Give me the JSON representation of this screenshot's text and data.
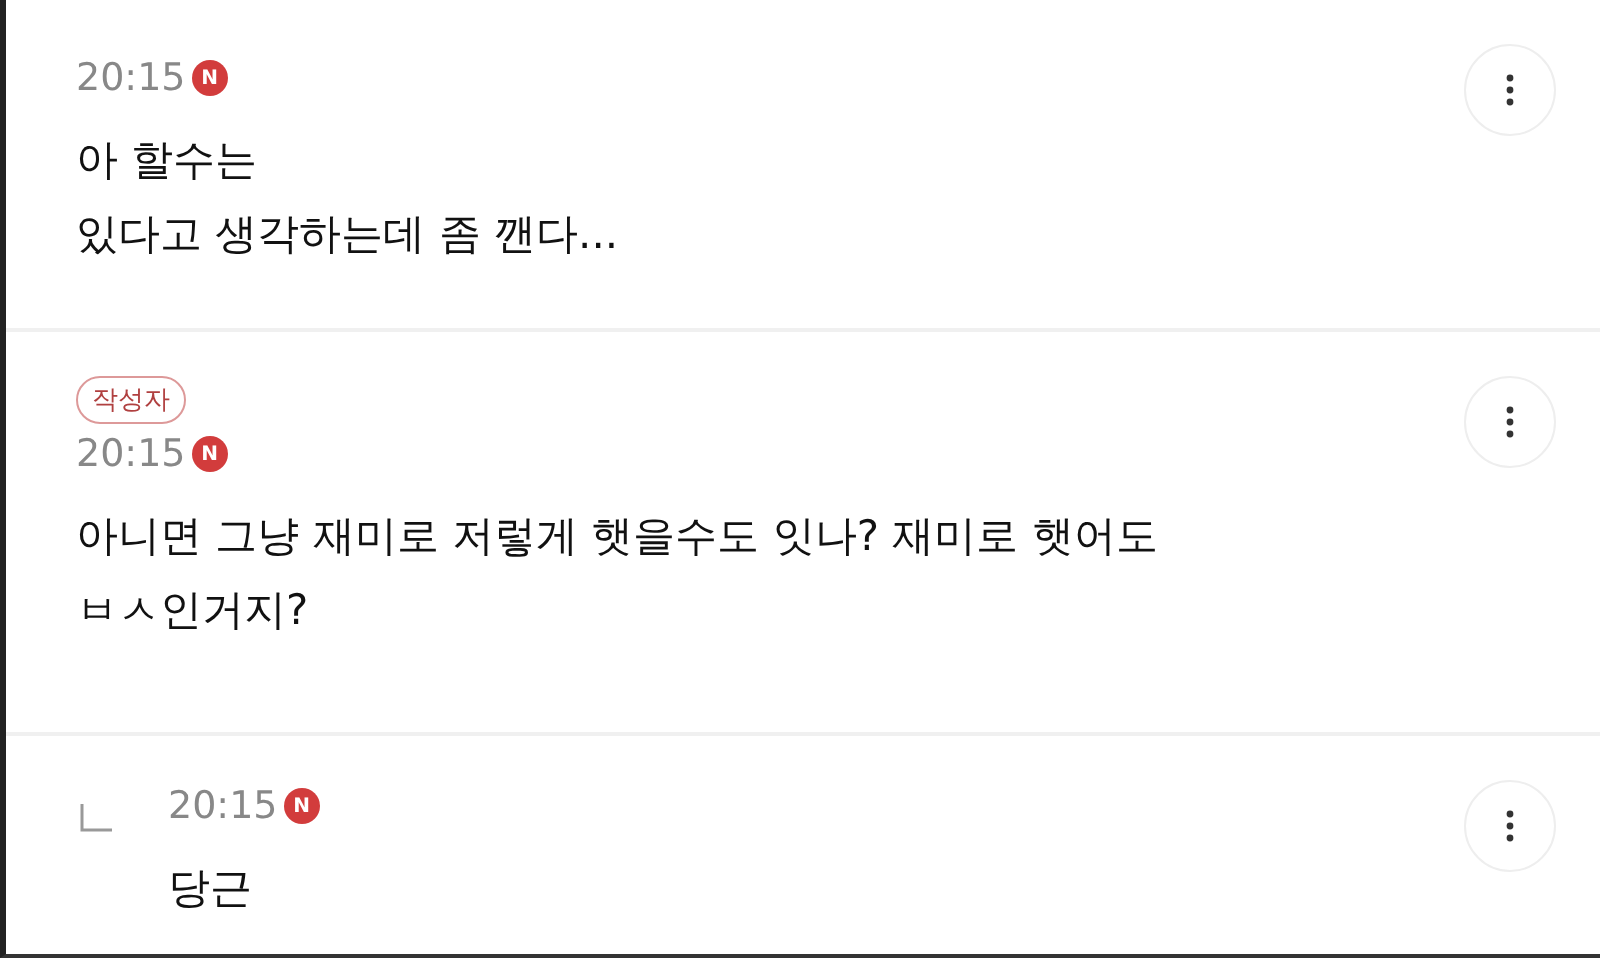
{
  "comments": [
    {
      "kind": "comment",
      "time": "20:15",
      "new_badge": "N",
      "lines": [
        "아 할수는",
        "있다고 생각하는데 좀 깬다..."
      ]
    },
    {
      "kind": "comment",
      "author_badge": "작성자",
      "time": "20:15",
      "new_badge": "N",
      "lines": [
        "아니면 그냥 재미로 저렇게 햇을수도 잇나? 재미로 햇어도",
        "ㅂㅅ인거지?"
      ]
    },
    {
      "kind": "reply",
      "time": "20:15",
      "new_badge": "N",
      "lines": [
        "당근"
      ]
    }
  ]
}
